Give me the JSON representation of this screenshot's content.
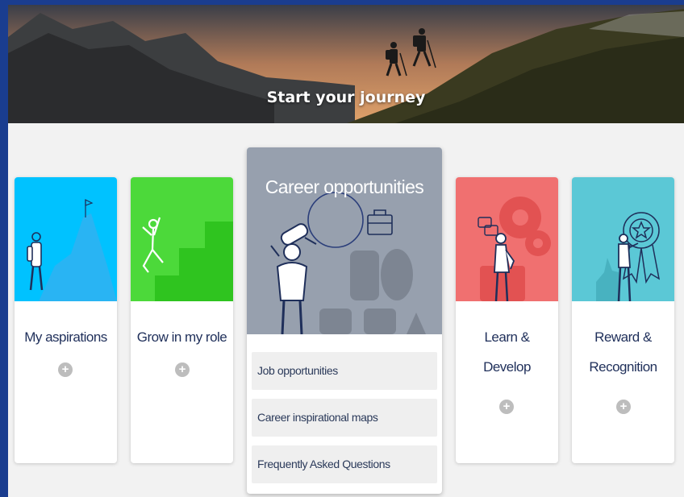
{
  "hero": {
    "title": "Start your journey"
  },
  "cards": {
    "aspirations": {
      "label": "My aspirations",
      "color": "#00c2ff"
    },
    "grow": {
      "label": "Grow in my role",
      "color": "#4cd93a"
    },
    "learn": {
      "label_line1": "Learn &",
      "label_line2": "Develop",
      "color": "#f07070"
    },
    "reward": {
      "label_line1": "Reward &",
      "label_line2": "Recognition",
      "color": "#5bc8d6"
    }
  },
  "career": {
    "title": "Career opportunities",
    "color": "#97a0ae",
    "menu": [
      {
        "label": "Job opportunities"
      },
      {
        "label": "Career inspirational maps"
      },
      {
        "label": "Frequently Asked Questions"
      }
    ]
  },
  "icons": {
    "plus": "+"
  }
}
